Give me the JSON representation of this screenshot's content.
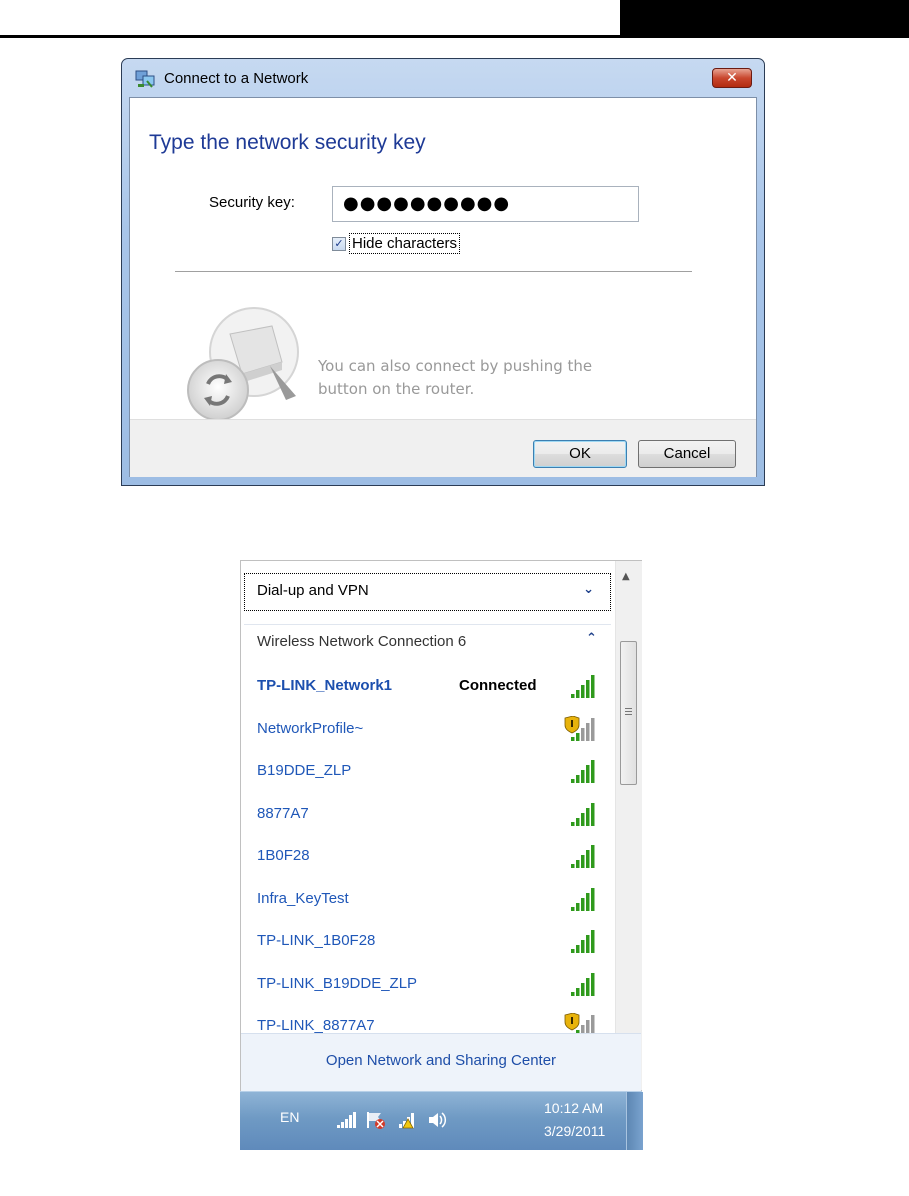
{
  "dialog": {
    "title": "Connect to a Network",
    "close_label": "✕",
    "heading": "Type the network security key",
    "key_label": "Security key:",
    "key_value": "●●●●●●●●●●",
    "hide_label": "Hide characters",
    "hide_checked": true,
    "router_text": "You can also connect by pushing the button on the router.",
    "ok_label": "OK",
    "cancel_label": "Cancel"
  },
  "flyout": {
    "vpn_label": "Dial-up and VPN",
    "section_label": "Wireless Network Connection 6",
    "networks": [
      {
        "name": "TP-LINK_Network1",
        "status": "Connected",
        "secured": false,
        "bold": true
      },
      {
        "name": "NetworkProfile~",
        "status": "",
        "secured": true,
        "bold": false
      },
      {
        "name": "B19DDE_ZLP",
        "status": "",
        "secured": false,
        "bold": false
      },
      {
        "name": "8877A7",
        "status": "",
        "secured": false,
        "bold": false
      },
      {
        "name": "1B0F28",
        "status": "",
        "secured": false,
        "bold": false
      },
      {
        "name": "Infra_KeyTest",
        "status": "",
        "secured": false,
        "bold": false
      },
      {
        "name": "TP-LINK_1B0F28",
        "status": "",
        "secured": false,
        "bold": false
      },
      {
        "name": "TP-LINK_B19DDE_ZLP",
        "status": "",
        "secured": false,
        "bold": false
      },
      {
        "name": "TP-LINK_8877A7",
        "status": "",
        "secured": true,
        "bold": false
      }
    ],
    "open_center": "Open Network and Sharing Center"
  },
  "taskbar": {
    "lang": "EN",
    "time": "10:12 AM",
    "date": "3/29/2011"
  },
  "colors": {
    "link_blue": "#1f57b8",
    "heading_blue": "#1e3a96",
    "signal_green": "#2f9a1c"
  }
}
